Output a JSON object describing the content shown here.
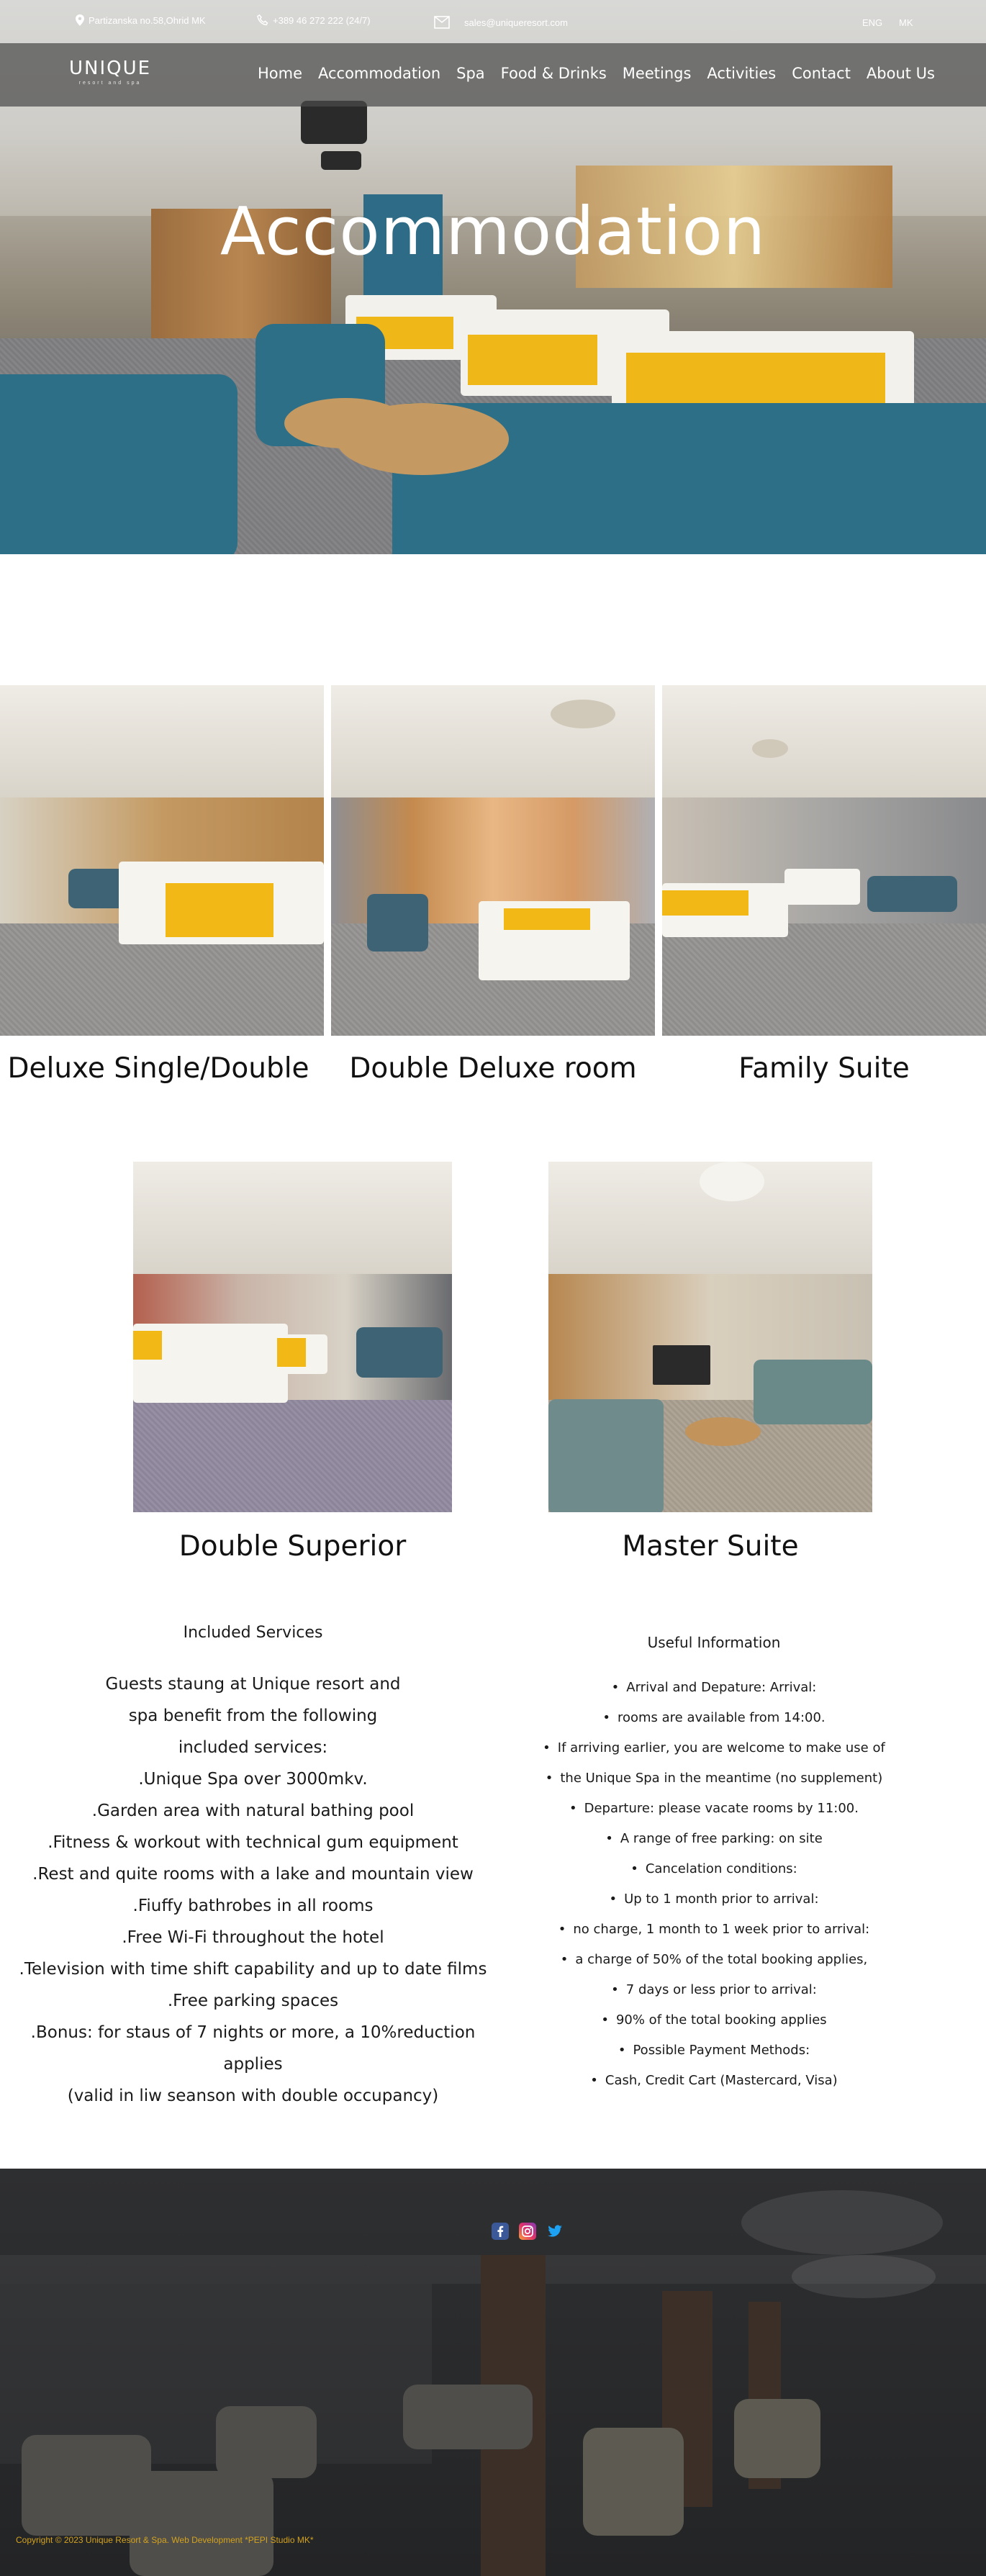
{
  "topbar": {
    "address": "Partizanska no.58,Ohrid MK",
    "phone": "+389 46 272 222 (24/7)",
    "email": "sales@uniqueresort.com",
    "lang_en": "ENG",
    "lang_mk": "MK",
    "icons": [
      "location-pin-icon",
      "phone-icon",
      "mail-icon"
    ]
  },
  "header": {
    "logo_word": "UNIQUE",
    "logo_sub": "resort and spa",
    "nav": [
      "Home",
      "Accommodation",
      "Spa",
      "Food & Drinks",
      "Meetings",
      "Activities",
      "Contact",
      "About Us"
    ]
  },
  "hero": {
    "title": "Accommodation"
  },
  "rooms": [
    {
      "name": "Deluxe Single/Double"
    },
    {
      "name": "Double Deluxe room"
    },
    {
      "name": "Family Suite"
    },
    {
      "name": "Double Superior"
    },
    {
      "name": "Master Suite"
    }
  ],
  "services": {
    "heading": "Included Services",
    "lines": [
      "Guests staung at Unique resort and",
      "spa benefit from the following",
      "included services:",
      ".Unique Spa over 3000mkv.",
      ".Garden area with natural bathing pool",
      ".Fitness & workout with technical gum equipment",
      ".Rest and quite rooms with a lake and mountain view",
      ".Fiuffy bathrobes in all rooms",
      ".Free Wi-Fi throughout the hotel",
      ".Television with time shift capability and up to date films",
      ".Free parking spaces",
      ".Bonus: for staus of 7 nights or more, a 10%reduction applies",
      "(valid in liw seanson with double occupancy)"
    ]
  },
  "useful": {
    "heading": "Useful Information",
    "items": [
      "Arrival and Depature: Arrival:",
      "rooms are available from 14:00.",
      "If arriving earlier, you are welcome to make use of",
      "the Unique Spa in the meantime (no supplement)",
      "Departure: please vacate rooms by 11:00.",
      "A range of free parking: on site",
      "Cancelation conditions:",
      "Up to 1 month prior to arrival:",
      "no charge, 1 month to 1 week prior to arrival:",
      "a charge of 50% of the total booking applies,",
      "7 days or less prior to arrival:",
      "90% of the total booking applies",
      "Possible Payment Methods:",
      "Cash, Credit Cart (Mastercard, Visa)"
    ]
  },
  "footer": {
    "social": [
      "facebook-icon",
      "instagram-icon",
      "twitter-icon"
    ],
    "copyright": "Copyright © 2023 Unique Resort & Spa. Web Development *PEPI Studio MK*",
    "accent": "#d4a21d"
  }
}
